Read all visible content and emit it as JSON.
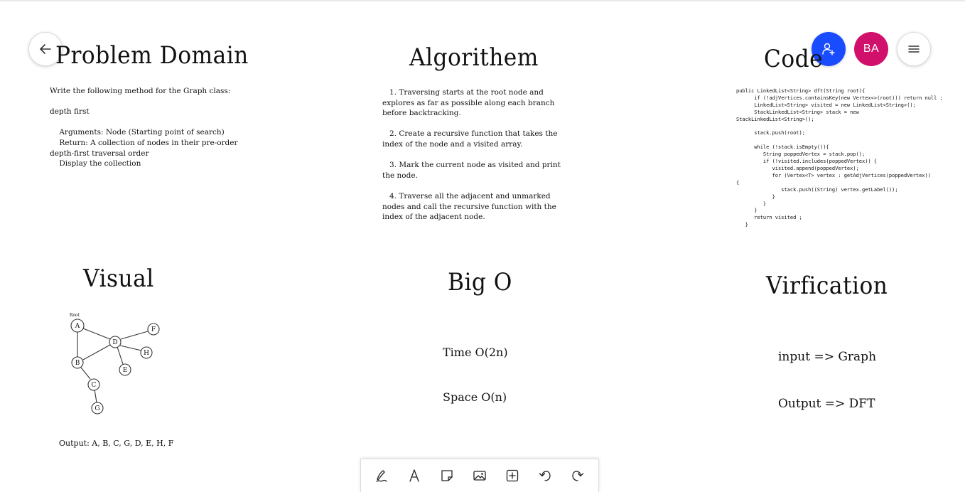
{
  "header": {
    "avatar_initials": "BA"
  },
  "icons": {
    "back": "arrow-left-icon",
    "share": "add-person-icon",
    "menu": "hamburger-menu-icon"
  },
  "colors": {
    "share_button": "#1a4cff",
    "avatar": "#d1106b"
  },
  "sections": {
    "problem_domain": {
      "title": "Problem Domain",
      "text": "Write the following method for the Graph class:\n\ndepth first\n\n    Arguments: Node (Starting point of search)\n    Return: A collection of nodes in their pre-order\ndepth-first traversal order\n    Display the collection"
    },
    "algorithm": {
      "title": "Algorithem",
      "text": "   1. Traversing starts at the root node and\nexplores as far as possible along each branch\nbefore backtracking.\n\n   2. Create a recursive function that takes the\nindex of the node and a visited array.\n\n   3. Mark the current node as visited and print\nthe node.\n\n   4. Traverse all the adjacent and unmarked\nnodes and call the recursive function with the\nindex of the adjacent node."
    },
    "code": {
      "title": "Code",
      "text": "public LinkedList<String> dft(String root){\n      if (!adjVertices.containsKey(new Vertex<>(root))) return null ;\n      LinkedList<String> visited = new LinkedList<String>();\n      StackLinkedList<String> stack = new\nStackLinkedList<String>();\n\n      stack.push(root);\n\n      while (!stack.isEmpty()){\n         String poppedVertex = stack.pop();\n         if (!visited.includes(poppedVertex)) {\n            visited.append(poppedVertex);\n            for (Vertex<T> vertex : getAdjVertices(poppedVertex))\n{\n               stack.push((String) vertex.getLabel());\n            }\n         }\n      }\n      return visited ;\n   }"
    },
    "visual": {
      "title": "Visual",
      "root_label": "Root",
      "nodes": [
        "A",
        "B",
        "C",
        "G",
        "D",
        "E",
        "F",
        "H"
      ],
      "output": "Output: A, B, C, G, D, E, H, F"
    },
    "big_o": {
      "title": "Big O",
      "time": "Time O(2n)",
      "space": "Space O(n)"
    },
    "verification": {
      "title": "Virfication",
      "input": "input => Graph",
      "output": "Output => DFT"
    }
  },
  "toolbar": {
    "tools": [
      "pen-icon",
      "text-icon",
      "sticky-note-icon",
      "image-icon",
      "add-icon",
      "undo-icon",
      "redo-icon"
    ]
  }
}
